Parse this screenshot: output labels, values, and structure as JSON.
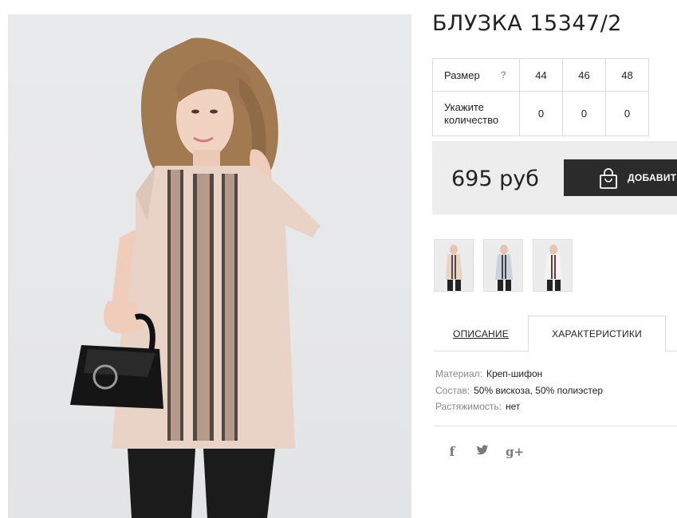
{
  "product": {
    "title": "БЛУЗКА 15347/2",
    "price": "695 руб",
    "add_to_cart_label": "ДОБАВИТ"
  },
  "size_table": {
    "size_label": "Размер",
    "help_glyph": "?",
    "qty_label": "Укажите количество",
    "sizes": [
      "44",
      "46",
      "48"
    ],
    "quantities": [
      "0",
      "0",
      "0"
    ]
  },
  "tabs": {
    "description": "ОПИСАНИЕ",
    "characteristics": "ХАРАКТЕРИСТИКИ",
    "active": "characteristics"
  },
  "specs": [
    {
      "key": "Материал:",
      "value": "Креп-шифон"
    },
    {
      "key": "Состав:",
      "value": "50% вискоза, 50% полиэстер"
    },
    {
      "key": "Растяжимость:",
      "value": "нет"
    }
  ],
  "social": {
    "facebook_glyph": "f",
    "twitter_glyph": "🐦",
    "google_glyph": "g+"
  },
  "colors": {
    "button_bg": "#2b2b2b",
    "price_box_bg": "#ededed",
    "blouse": "#e8d3c6",
    "lace": "#3a2f2b"
  }
}
